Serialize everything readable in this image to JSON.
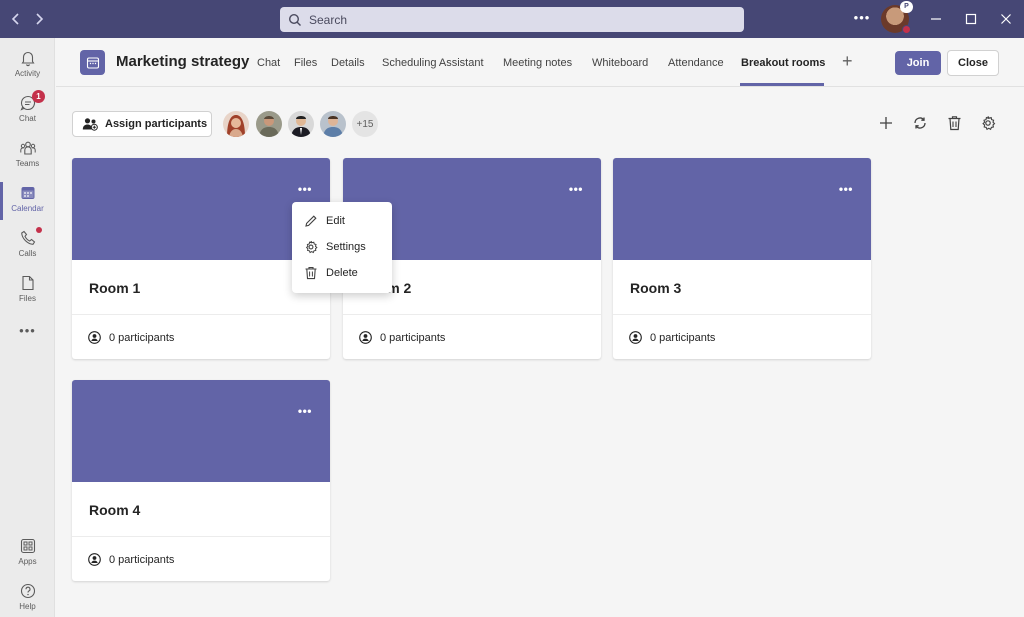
{
  "titlebar": {
    "search_placeholder": "Search",
    "more": "•••",
    "avatar_badge": "P"
  },
  "rail": {
    "items": [
      {
        "label": "Activity",
        "icon": "bell-icon"
      },
      {
        "label": "Chat",
        "icon": "chat-icon",
        "badge": "1"
      },
      {
        "label": "Teams",
        "icon": "teams-icon"
      },
      {
        "label": "Calendar",
        "icon": "calendar-icon",
        "active": true
      },
      {
        "label": "Calls",
        "icon": "phone-icon",
        "dot": true
      },
      {
        "label": "Files",
        "icon": "file-icon"
      }
    ],
    "more": "•••",
    "bottom_items": [
      {
        "label": "Apps",
        "icon": "apps-icon"
      },
      {
        "label": "Help",
        "icon": "help-icon"
      }
    ]
  },
  "meeting": {
    "title": "Marketing strategy",
    "tabs": [
      "Chat",
      "Files",
      "Details",
      "Scheduling Assistant",
      "Meeting notes",
      "Whiteboard",
      "Attendance",
      "Breakout rooms"
    ],
    "active_tab": "Breakout rooms",
    "add_tab": "+",
    "join_label": "Join",
    "close_label": "Close"
  },
  "toolbar": {
    "assign_label": "Assign participants",
    "more_participants": "+15"
  },
  "rooms": [
    {
      "name": "Room 1",
      "participants": "0 participants"
    },
    {
      "name": "Room 2",
      "participants": "0 participants"
    },
    {
      "name": "Room 3",
      "participants": "0 participants"
    },
    {
      "name": "Room 4",
      "participants": "0 participants"
    }
  ],
  "card_more": "•••",
  "context_menu": {
    "items": [
      "Edit",
      "Settings",
      "Delete"
    ]
  },
  "colors": {
    "brand": "#6264a7",
    "titlebar": "#464775",
    "badge": "#c4314b"
  }
}
